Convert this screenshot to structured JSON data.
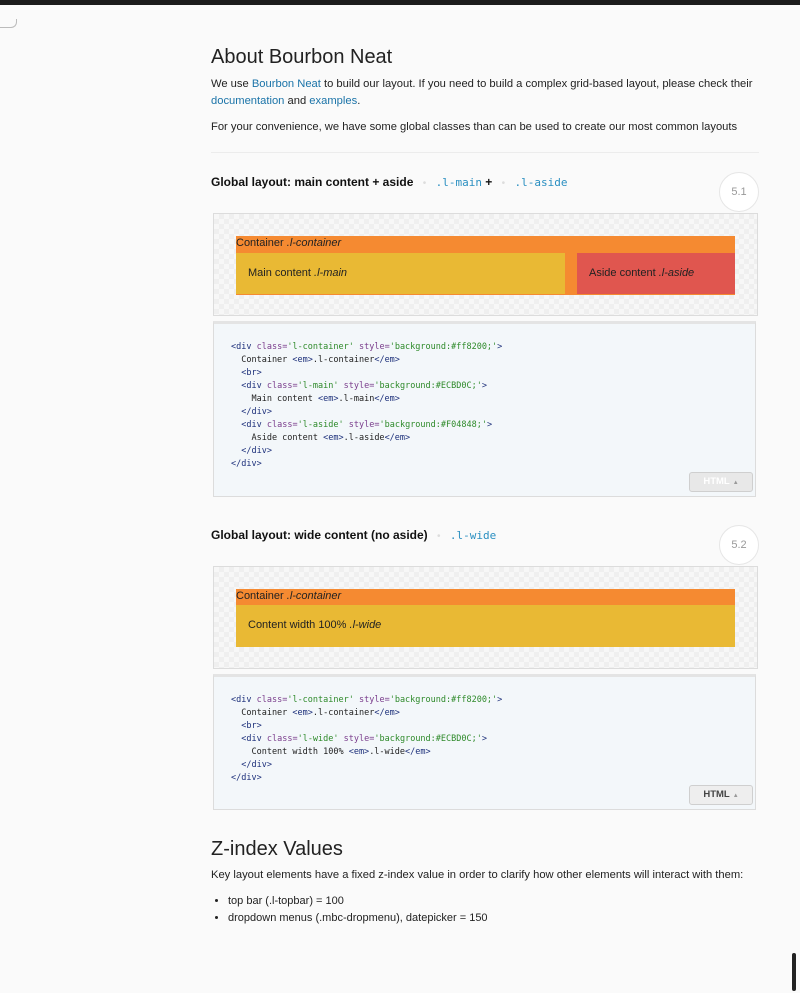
{
  "about": {
    "title": "About Bourbon Neat",
    "p1_before": "We use ",
    "p1_link": "Bourbon Neat",
    "p1_middle": " to build our layout. If you need to build a complex grid-based layout, please check their ",
    "p1_link2": "documentation",
    "p1_and": " and ",
    "p1_link3": "examples",
    "p1_end": ".",
    "p2": "For your convenience, we have some global classes than can be used to create our most common layouts"
  },
  "section1": {
    "title": "Global layout: main content + aside",
    "code1": ".l-main",
    "plus": "+",
    "code2": ".l-aside",
    "badge": "5.1",
    "container_label": "Container ",
    "container_class": ".l-container",
    "main_label": "Main content ",
    "main_class": ".l-main",
    "aside_label": "Aside content ",
    "aside_class": ".l-aside",
    "html_button": "HTML"
  },
  "section2": {
    "title": "Global layout: wide content (no aside)",
    "code1": ".l-wide",
    "badge": "5.2",
    "container_label": "Container ",
    "container_class": ".l-container",
    "wide_label": "Content width 100% ",
    "wide_class": ".l-wide",
    "html_button": "HTML"
  },
  "code1_lines": [
    "<div class='l-container' style='background:#ff8200;'>",
    "  Container <em>.l-container</em>",
    "  <br>",
    "  <div class='l-main' style='background:#ECBD0C;'>",
    "    Main content <em>.l-main</em>",
    "  </div>",
    "  <div class='l-aside' style='background:#F04848;'>",
    "    Aside content <em>.l-aside</em>",
    "  </div>",
    "</div>"
  ],
  "code2_lines": [
    "<div class='l-container' style='background:#ff8200;'>",
    "  Container <em>.l-container</em>",
    "  <br>",
    "  <div class='l-wide' style='background:#ECBD0C;'>",
    "    Content width 100% <em>.l-wide</em>",
    "  </div>",
    "</div>"
  ],
  "zindex": {
    "title": "Z-index Values",
    "intro": "Key layout elements have a fixed z-index value in order to clarify how other elements will interact with them:",
    "items": [
      "top bar (.l-topbar) = 100",
      "dropdown menus (.mbc-dropmenu), datepicker = 150"
    ]
  },
  "colors": {
    "container": "#f58a31",
    "main": "#e9b934",
    "aside": "#e0564f",
    "link": "#1a73a8"
  }
}
